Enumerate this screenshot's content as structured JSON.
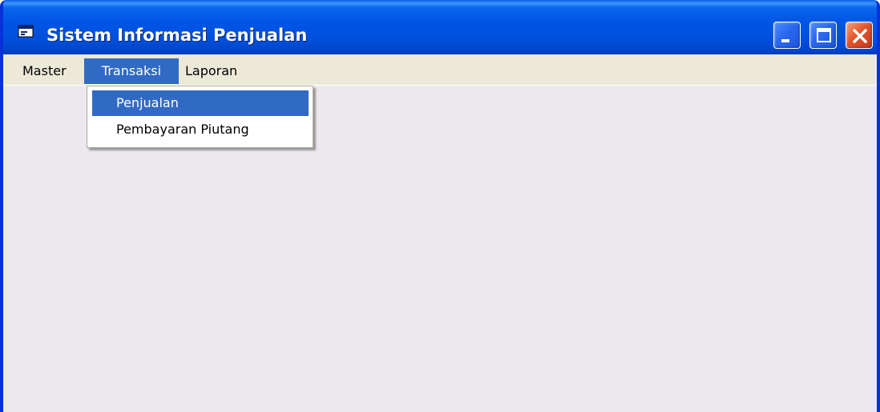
{
  "window": {
    "title": "Sistem Informasi Penjualan",
    "icon": "app-window-icon",
    "controls": {
      "minimize": "minimize-icon",
      "maximize": "maximize-icon",
      "close": "close-icon"
    }
  },
  "menubar": {
    "items": [
      {
        "label": "Master",
        "state": "normal"
      },
      {
        "label": "Transaksi",
        "state": "open"
      },
      {
        "label": "Laporan",
        "state": "normal"
      }
    ]
  },
  "dropdown": {
    "parent": "Transaksi",
    "items": [
      {
        "label": "Penjualan",
        "state": "highlighted"
      },
      {
        "label": "Pembayaran Piutang",
        "state": "normal"
      }
    ]
  },
  "colors": {
    "titlebar": "#0055e5",
    "frame": "#0831d9",
    "highlight": "#316ac5",
    "client": "#ebe9ee",
    "close_button": "#e2552c"
  }
}
